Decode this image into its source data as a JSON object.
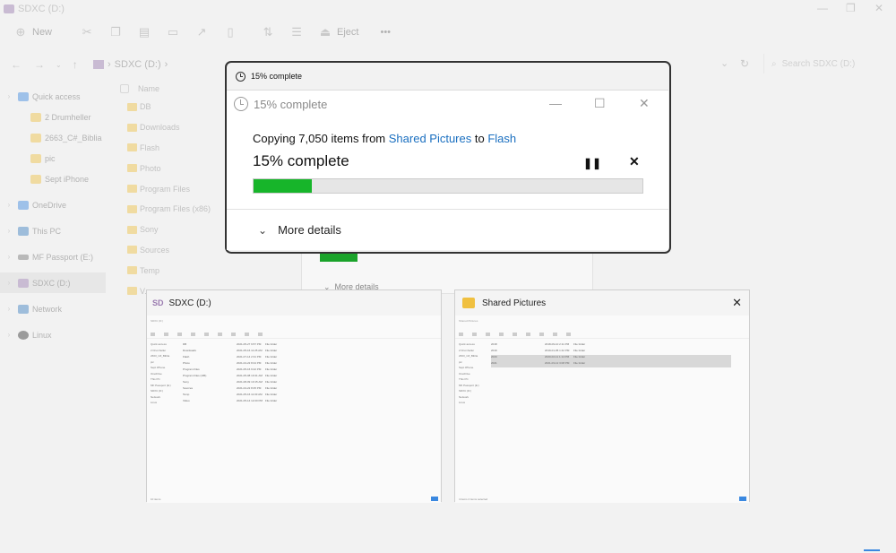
{
  "window": {
    "title": "SDXC (D:)",
    "controls": {
      "minimize": "—",
      "maximize": "❐",
      "close": "✕"
    }
  },
  "toolbar": {
    "new_label": "New",
    "eject_label": "Eject",
    "more_label": "•••"
  },
  "address": {
    "path": "SDXC (D:)",
    "chevron": "›",
    "search_placeholder": "Search SDXC (D:)"
  },
  "sidebar": {
    "items": [
      {
        "label": "Quick access",
        "icon": "star-icon"
      },
      {
        "label": "2 Drumheller",
        "icon": "folder-icon"
      },
      {
        "label": "2663_C#_Biblia",
        "icon": "folder-icon"
      },
      {
        "label": "pic",
        "icon": "folder-icon"
      },
      {
        "label": "Sept iPhone",
        "icon": "folder-icon"
      },
      {
        "label": "OneDrive",
        "icon": "cloud-icon"
      },
      {
        "label": "This PC",
        "icon": "pc-icon"
      },
      {
        "label": "MF Passport (E:)",
        "icon": "drive-icon"
      },
      {
        "label": "SDXC (D:)",
        "icon": "sd-card-icon"
      },
      {
        "label": "Network",
        "icon": "network-icon"
      },
      {
        "label": "Linux",
        "icon": "linux-icon"
      }
    ]
  },
  "files": {
    "column_name": "Name",
    "rows": [
      "DB",
      "Downloads",
      "Flash",
      "Photo",
      "Program Files",
      "Program Files (x86)",
      "Sony",
      "Sources",
      "Temp",
      "V..."
    ]
  },
  "dialog": {
    "mini_title": "15% complete",
    "title": "15% complete",
    "copy_prefix": "Copying 7,050 items from",
    "source": "Shared Pictures",
    "to_word": "to",
    "destination": "Flash",
    "percent_text": "15% complete",
    "progress": 0.15,
    "pause_glyph": "❚❚",
    "cancel_glyph": "✕",
    "more_details": "More details",
    "ghost_more": "More details"
  },
  "thumbnails": [
    {
      "title": "SDXC (D:)",
      "nav": [
        "Quick access",
        "2 Drumheller",
        "2663_C#_Biblia",
        "pic",
        "Sept iPhone",
        "OneDrive",
        "This PC",
        "MF Passport (E:)",
        "SDXC (D:)",
        "Network",
        "Linux"
      ],
      "files": [
        {
          "name": "DB",
          "date": "2021-05-27 9:57 PM",
          "type": "File folder"
        },
        {
          "name": "Downloads",
          "date": "2021-05-16 11:25 AM",
          "type": "File folder"
        },
        {
          "name": "Flash",
          "date": "2021-07-14 2:31 PM",
          "type": "File folder"
        },
        {
          "name": "Photo",
          "date": "2021-04-22 8:44 PM",
          "type": "File folder"
        },
        {
          "name": "Program Files",
          "date": "2021-05-16 9:22 PM",
          "type": "File folder"
        },
        {
          "name": "Program Files (x86)",
          "date": "2021-05-08 10:41 AM",
          "type": "File folder"
        },
        {
          "name": "Sony",
          "date": "2021-08-09 10:15 AM",
          "type": "File folder"
        },
        {
          "name": "Sources",
          "date": "2021-04-22 8:45 PM",
          "type": "File folder"
        },
        {
          "name": "Temp",
          "date": "2021-05-16 11:03 AM",
          "type": "File folder"
        },
        {
          "name": "Video",
          "date": "2021-05-14 12:20 PM",
          "type": "File folder"
        }
      ],
      "status": "10 items"
    },
    {
      "title": "Shared Pictures",
      "nav": [
        "Quick access",
        "2 Drumheller",
        "2663_C#_Biblia",
        "pic",
        "Sept iPhone",
        "OneDrive",
        "This PC",
        "MF Passport (E:)",
        "SDXC (D:)",
        "Network",
        "Linux"
      ],
      "files": [
        {
          "name": "2018",
          "date": "2018-09-10 2:11 PM",
          "type": "File folder"
        },
        {
          "name": "2019",
          "date": "2019-01-05 1:42 PM",
          "type": "File folder"
        },
        {
          "name": "2020",
          "date": "2020-02-11 1:14 PM",
          "type": "File folder"
        },
        {
          "name": "2021",
          "date": "2021-03-12 3:08 PM",
          "type": "File folder"
        }
      ],
      "status": "4 items  2 items selected"
    }
  ]
}
